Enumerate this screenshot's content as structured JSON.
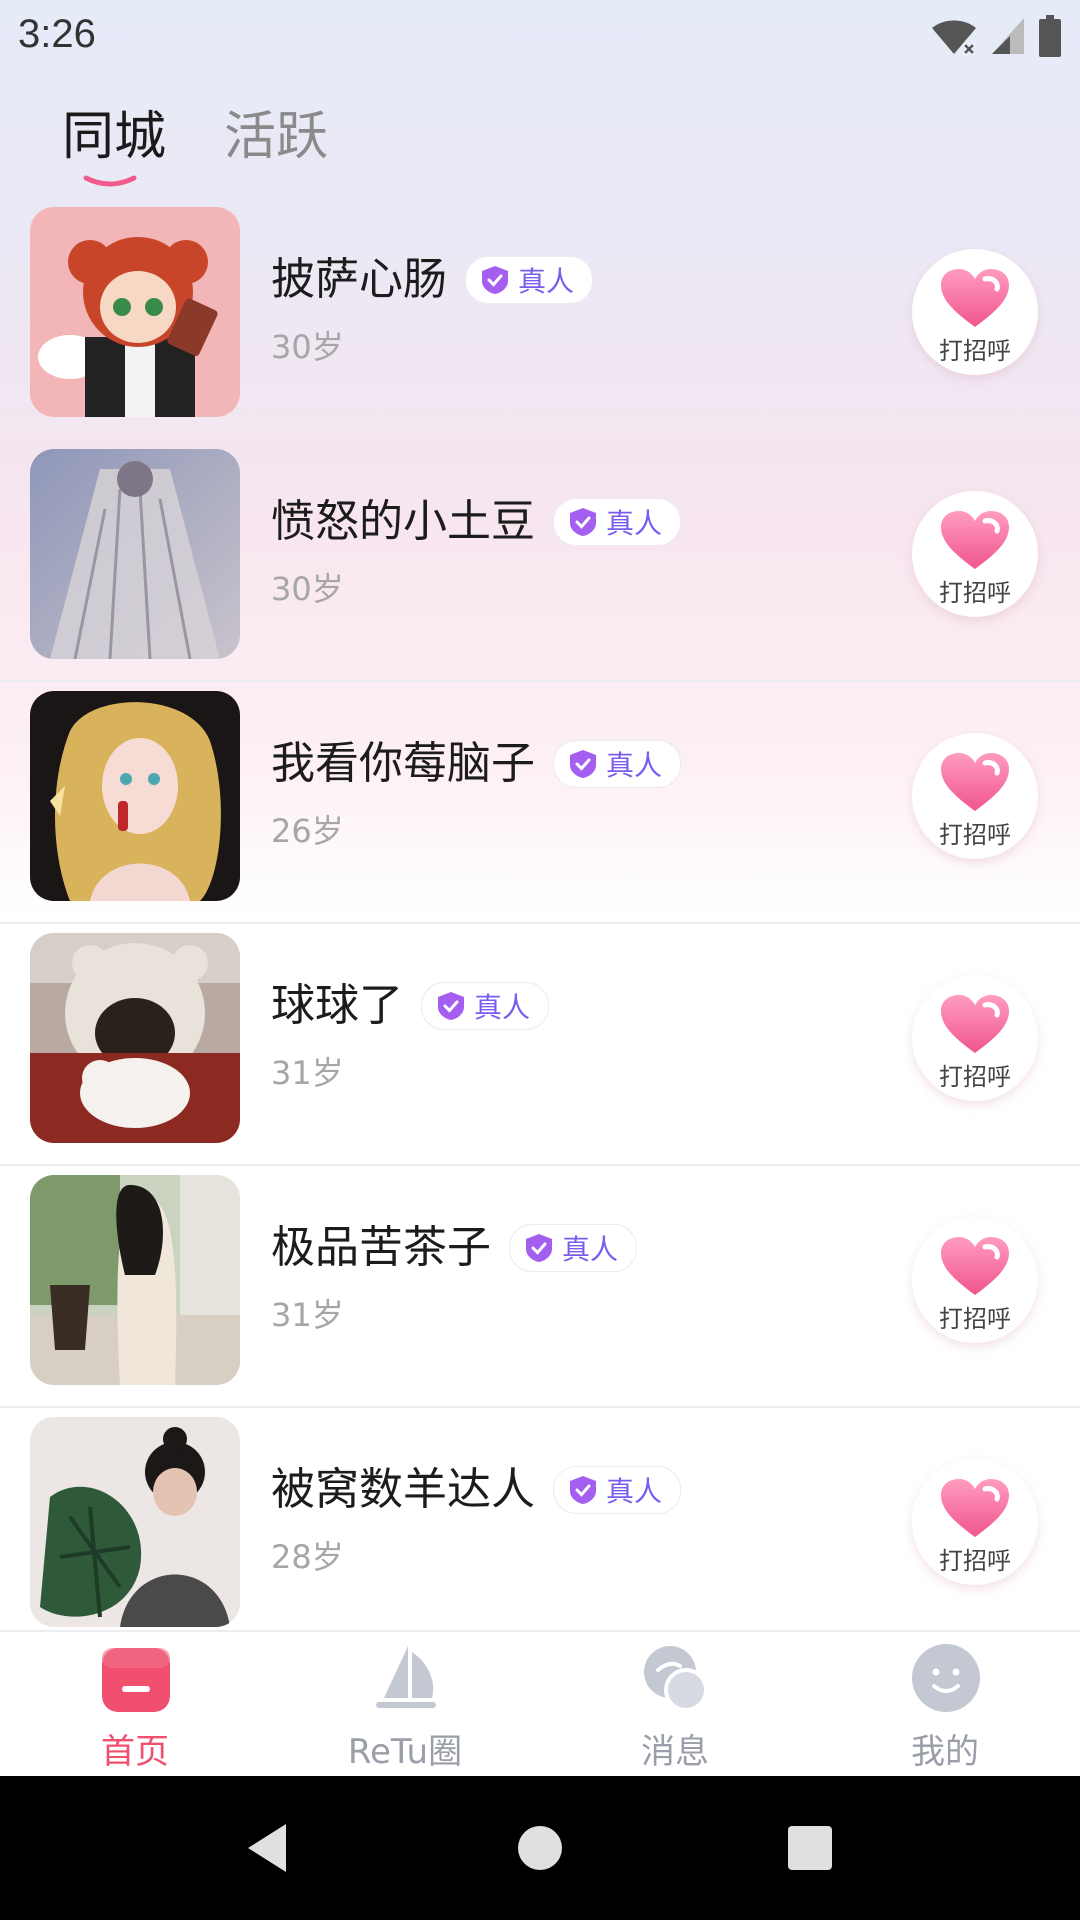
{
  "status_bar": {
    "time": "3:26"
  },
  "tabs": [
    {
      "label": "同城",
      "active": true
    },
    {
      "label": "活跃",
      "active": false
    }
  ],
  "users": [
    {
      "name": "披萨心肠",
      "badge": "真人",
      "age": "30岁",
      "greet": "打招呼"
    },
    {
      "name": "愤怒的小土豆",
      "badge": "真人",
      "age": "30岁",
      "greet": "打招呼"
    },
    {
      "name": "我看你莓脑子",
      "badge": "真人",
      "age": "26岁",
      "greet": "打招呼"
    },
    {
      "name": "球球了",
      "badge": "真人",
      "age": "31岁",
      "greet": "打招呼"
    },
    {
      "name": "极品苦茶子",
      "badge": "真人",
      "age": "31岁",
      "greet": "打招呼"
    },
    {
      "name": "被窝数羊达人",
      "badge": "真人",
      "age": "28岁",
      "greet": "打招呼"
    }
  ],
  "bottom_nav": [
    {
      "label": "首页",
      "active": true,
      "icon": "home-icon"
    },
    {
      "label": "ReTu圈",
      "active": false,
      "icon": "sail-icon"
    },
    {
      "label": "消息",
      "active": false,
      "icon": "chat-bubbles-icon"
    },
    {
      "label": "我的",
      "active": false,
      "icon": "smiley-face-icon"
    }
  ],
  "colors": {
    "accent": "#f0506e",
    "badge_text": "#7a5cf0",
    "badge_icon": "#a45ef0",
    "heart": "#f77aa6",
    "inactive": "#a8acb8"
  }
}
